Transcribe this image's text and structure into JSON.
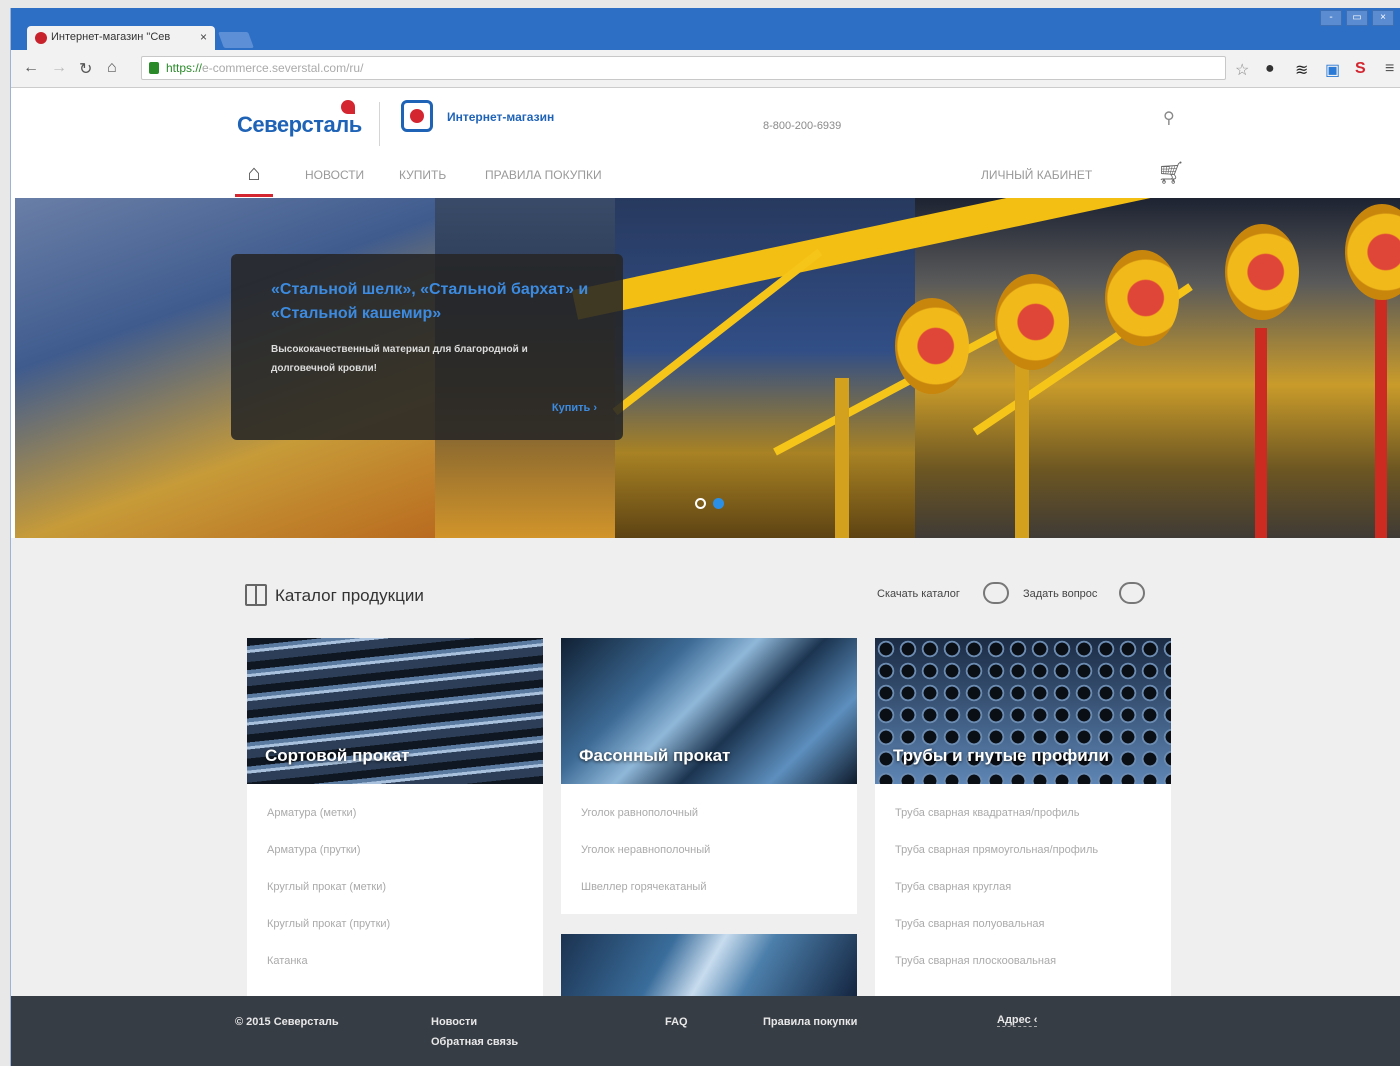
{
  "browser": {
    "tab_title": "Интернет-магазин \"Сев",
    "tab_close": "×",
    "url_scheme": "https://",
    "url_rest": "e-commerce.severstal.com/ru/",
    "window_controls": [
      "-",
      "▭",
      "×"
    ]
  },
  "site": {
    "logo": "Северсталь",
    "shop_label": "Интернет-магазин",
    "phone": "8-800-200-6939",
    "nav": [
      "Новости",
      "Купить",
      "Правила покупки"
    ],
    "account": "Личный кабинет"
  },
  "hero": {
    "promo_title": "«Стальной шелк», «Стальной бархат» и «Стальной кашемир»",
    "promo_text": "Высококачественный материал для благородной и долговечной кровли!",
    "promo_buy": "Купить  ›",
    "slides_total": 2,
    "active_slide": 2
  },
  "catalog": {
    "title": "Каталог продукции",
    "download": "Скачать каталог",
    "ask": "Задать вопрос",
    "cards": [
      {
        "caption": "Сортовой прокат",
        "items": [
          "Арматура (метки)",
          "Арматура (прутки)",
          "Круглый прокат (метки)",
          "Круглый прокат (прутки)",
          "Катанка"
        ]
      },
      {
        "caption": "Фасонный прокат",
        "items": [
          "Уголок равнополочный",
          "Уголок неравнополочный",
          "Швеллер горячекатаный"
        ]
      },
      {
        "caption": "Трубы и гнутые профили",
        "items": [
          "Труба сварная квадратная/профиль",
          "Труба сварная прямоугольная/профиль",
          "Труба сварная круглая",
          "Труба сварная полуовальная",
          "Труба сварная плоскоовальная"
        ]
      }
    ]
  },
  "footer": {
    "copyright": "© 2015 Северсталь",
    "news": "Новости",
    "feedback": "Обратная связь",
    "faq": "FAQ",
    "rules": "Правила покупки",
    "address": "Адрес ‹"
  },
  "colors": {
    "brand_blue": "#1f63b7",
    "brand_red": "#d32630",
    "accent_blue": "#3c8be0",
    "footer_bg": "#373d45"
  }
}
